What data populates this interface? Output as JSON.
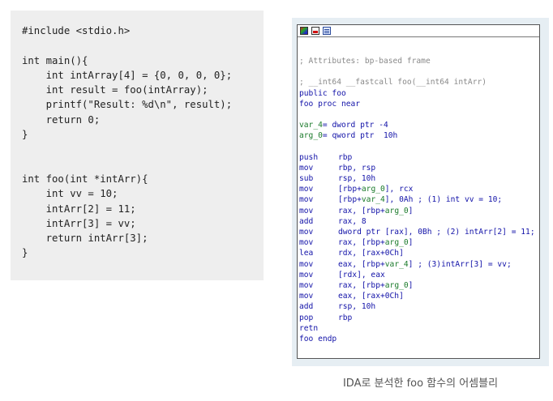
{
  "c_source": {
    "code": "#include <stdio.h>\n\nint main(){\n    int intArray[4] = {0, 0, 0, 0};\n    int result = foo(intArray);\n    printf(\"Result: %d\\n\", result);\n    return 0;\n}\n\n\nint foo(int *intArr){\n    int vv = 10;\n    intArr[2] = 11;\n    intArr[3] = vv;\n    return intArr[3];\n}"
  },
  "ida": {
    "toolbar_icons": [
      "graph-view-icon",
      "flow-chart-icon",
      "text-view-icon"
    ],
    "comment_attributes": "; Attributes: bp-based frame",
    "comment_signature": "; __int64 __fastcall foo(__int64 intArr)",
    "public_line": "public foo",
    "proc_line": "foo proc near",
    "vars": [
      {
        "name": "var_4",
        "text": "= dword ptr -4"
      },
      {
        "name": "arg_0",
        "text": "= qword ptr  10h"
      }
    ],
    "instructions": [
      {
        "mnemonic": "push",
        "parts": [
          [
            "rbp",
            "b"
          ]
        ]
      },
      {
        "mnemonic": "mov",
        "parts": [
          [
            "rbp, rsp",
            "b"
          ]
        ]
      },
      {
        "mnemonic": "sub",
        "parts": [
          [
            "rsp, 10h",
            "b"
          ]
        ]
      },
      {
        "mnemonic": "mov",
        "parts": [
          [
            "[rbp+",
            "b"
          ],
          [
            "arg_0",
            "g"
          ],
          [
            "], rcx",
            "b"
          ]
        ]
      },
      {
        "mnemonic": "mov",
        "parts": [
          [
            "[rbp+",
            "b"
          ],
          [
            "var_4",
            "g"
          ],
          [
            "], 0Ah ; (1) int vv = 10;",
            "b"
          ]
        ]
      },
      {
        "mnemonic": "mov",
        "parts": [
          [
            "rax, [rbp+",
            "b"
          ],
          [
            "arg_0",
            "g"
          ],
          [
            "]",
            "b"
          ]
        ]
      },
      {
        "mnemonic": "add",
        "parts": [
          [
            "rax, 8",
            "b"
          ]
        ]
      },
      {
        "mnemonic": "mov",
        "parts": [
          [
            "dword ptr [rax], 0Bh ; (2) intArr[2] = 11;",
            "b"
          ]
        ]
      },
      {
        "mnemonic": "mov",
        "parts": [
          [
            "rax, [rbp+",
            "b"
          ],
          [
            "arg_0",
            "g"
          ],
          [
            "]",
            "b"
          ]
        ]
      },
      {
        "mnemonic": "lea",
        "parts": [
          [
            "rdx, [rax+0Ch]",
            "b"
          ]
        ]
      },
      {
        "mnemonic": "mov",
        "parts": [
          [
            "eax, [rbp+",
            "b"
          ],
          [
            "var_4",
            "g"
          ],
          [
            "] ; (3)intArr[3] = vv;",
            "b"
          ]
        ]
      },
      {
        "mnemonic": "mov",
        "parts": [
          [
            "[rdx], eax",
            "b"
          ]
        ]
      },
      {
        "mnemonic": "mov",
        "parts": [
          [
            "rax, [rbp+",
            "b"
          ],
          [
            "arg_0",
            "g"
          ],
          [
            "]",
            "b"
          ]
        ]
      },
      {
        "mnemonic": "mov",
        "parts": [
          [
            "eax, [rax+0Ch]",
            "b"
          ]
        ]
      },
      {
        "mnemonic": "add",
        "parts": [
          [
            "rsp, 10h",
            "b"
          ]
        ]
      },
      {
        "mnemonic": "pop",
        "parts": [
          [
            "rbp",
            "b"
          ]
        ]
      },
      {
        "mnemonic": "retn",
        "parts": []
      }
    ],
    "endp_line": "foo endp"
  },
  "caption": "IDA로 분석한 foo 함수의 어셈블리",
  "colors": {
    "panel_bg": "#eeeeee",
    "ida_blue": "#1212a8",
    "ida_green": "#1a7a2a",
    "ida_comment": "#8a8a8a"
  }
}
